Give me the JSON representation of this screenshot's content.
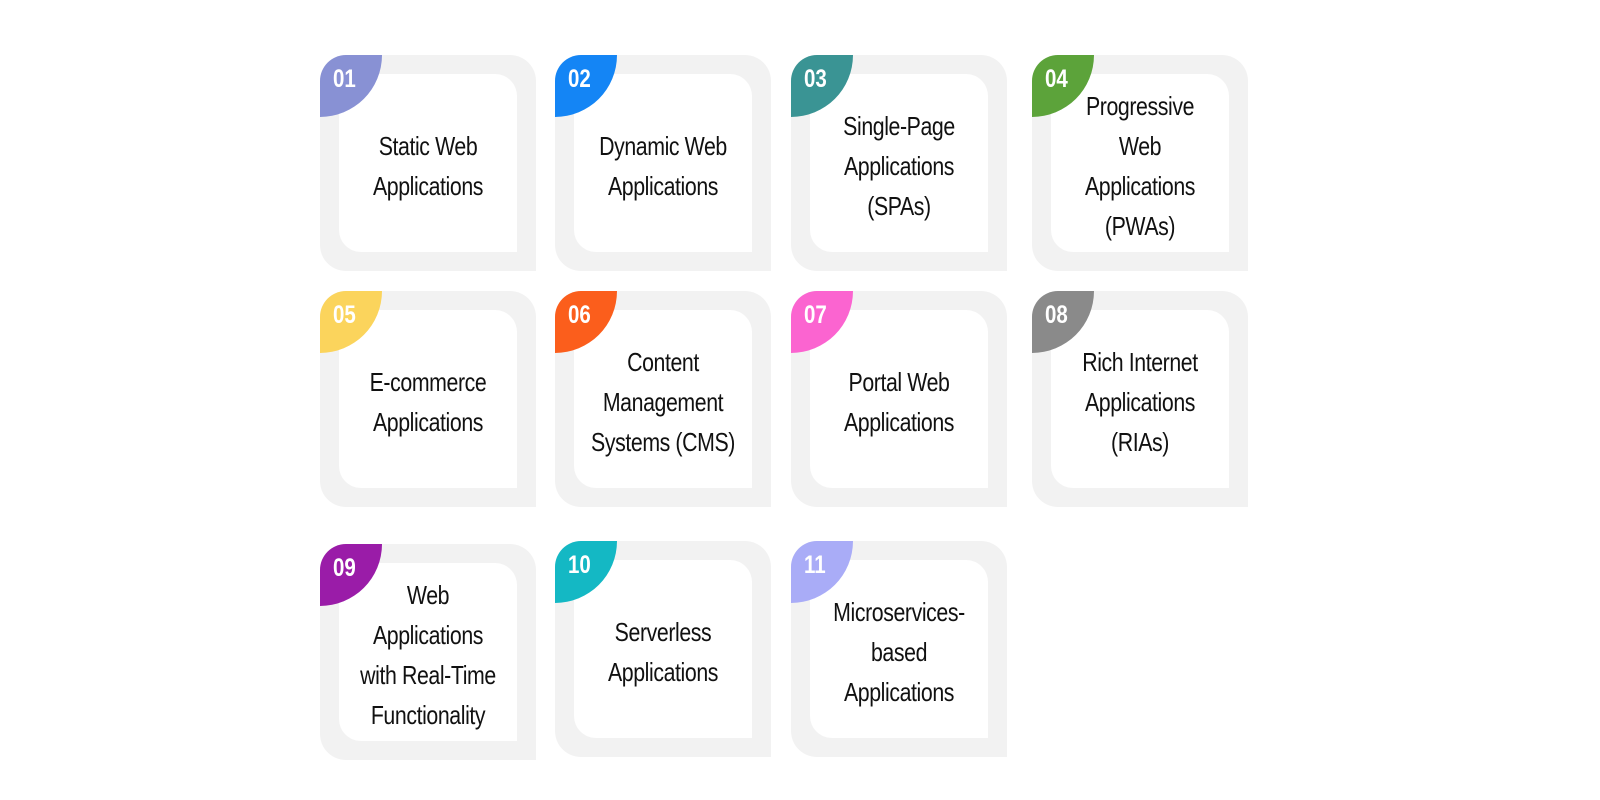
{
  "cards": [
    {
      "number": "01",
      "title": "Static Web Applications",
      "color": "#8891d4"
    },
    {
      "number": "02",
      "title": "Dynamic Web Applications",
      "color": "#1485f5"
    },
    {
      "number": "03",
      "title": "Single-Page Applications (SPAs)",
      "color": "#3a9494"
    },
    {
      "number": "04",
      "title": "Progressive Web Applications (PWAs)",
      "color": "#5ca33a"
    },
    {
      "number": "05",
      "title": "E-commerce Applications",
      "color": "#fbd45c"
    },
    {
      "number": "06",
      "title": "Content Management Systems (CMS)",
      "color": "#fb5e1c"
    },
    {
      "number": "07",
      "title": "Portal Web Applications",
      "color": "#fb64d0"
    },
    {
      "number": "08",
      "title": "Rich Internet Applications (RIAs)",
      "color": "#8a8a8a"
    },
    {
      "number": "09",
      "title": "Web Applications with Real-Time Functionality",
      "color": "#9a1ca8"
    },
    {
      "number": "10",
      "title": "Serverless Applications",
      "color": "#14b8c4"
    },
    {
      "number": "11",
      "title": "Microservices-based Applications",
      "color": "#a9acf7"
    }
  ]
}
